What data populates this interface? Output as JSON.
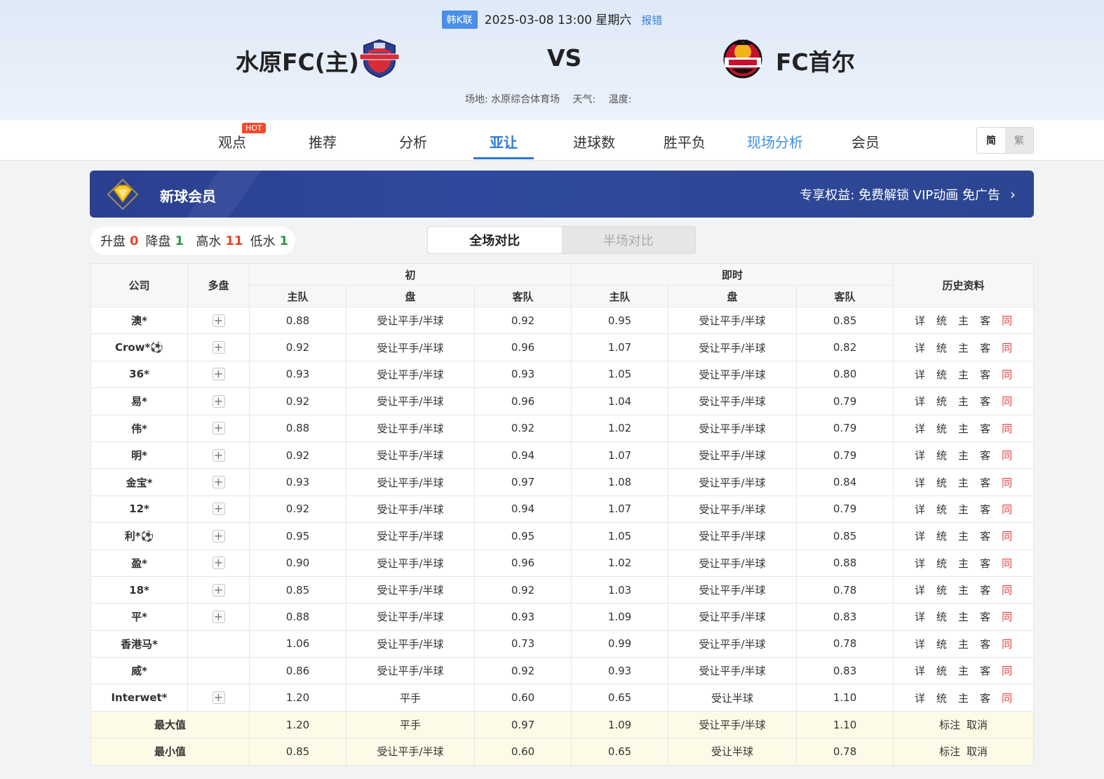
{
  "header": {
    "league": "韩K联",
    "datetime": "2025-03-08 13:00 星期六",
    "report": "报错",
    "home_team": "水原FC(主)",
    "vs": "VS",
    "away_team": "FC首尔",
    "venue": "场地: 水原综合体育场",
    "weather": "天气:",
    "temperature": "温度:"
  },
  "tabs": [
    {
      "label": "观点"
    },
    {
      "label": "推荐"
    },
    {
      "label": "分析"
    },
    {
      "label": "亚让"
    },
    {
      "label": "进球数"
    },
    {
      "label": "胜平负"
    },
    {
      "label": "现场分析"
    },
    {
      "label": "会员"
    }
  ],
  "hot_badge": "HOT",
  "lang": {
    "simplified": "简",
    "traditional": "繁"
  },
  "vip": {
    "title": "新球会员",
    "right": "专享权益: 免费解锁 VIP动画 免广告",
    "chevron": "›"
  },
  "stats": {
    "up_label": "升盘",
    "up_value": "0",
    "down_label": "降盘",
    "down_value": "1",
    "high_label": "高水",
    "high_value": "11",
    "low_label": "低水",
    "low_value": "1"
  },
  "toggle": {
    "full": "全场对比",
    "half": "半场对比"
  },
  "table": {
    "headers": {
      "company": "公司",
      "multi": "多盘",
      "initial": "初",
      "live": "即时",
      "history": "历史资料",
      "home": "主队",
      "line": "盘",
      "away": "客队"
    },
    "history_links": [
      "详",
      "统",
      "主",
      "客",
      "同"
    ],
    "plus": "+",
    "rows": [
      {
        "company": "澳*",
        "plus": true,
        "i_home": "0.88",
        "i_line": "受让平手/半球",
        "i_away": "0.92",
        "l_home": "0.95",
        "l_line": "受让平手/半球",
        "l_away": "0.85"
      },
      {
        "company": "Crow*⚽",
        "plus": true,
        "i_home": "0.92",
        "i_line": "受让平手/半球",
        "i_away": "0.96",
        "l_home": "1.07",
        "l_line": "受让平手/半球",
        "l_away": "0.82"
      },
      {
        "company": "36*",
        "plus": true,
        "i_home": "0.93",
        "i_line": "受让平手/半球",
        "i_away": "0.93",
        "l_home": "1.05",
        "l_line": "受让平手/半球",
        "l_away": "0.80"
      },
      {
        "company": "易*",
        "plus": true,
        "i_home": "0.92",
        "i_line": "受让平手/半球",
        "i_away": "0.96",
        "l_home": "1.04",
        "l_line": "受让平手/半球",
        "l_away": "0.79"
      },
      {
        "company": "伟*",
        "plus": true,
        "i_home": "0.88",
        "i_line": "受让平手/半球",
        "i_away": "0.92",
        "l_home": "1.02",
        "l_line": "受让平手/半球",
        "l_away": "0.79"
      },
      {
        "company": "明*",
        "plus": true,
        "i_home": "0.92",
        "i_line": "受让平手/半球",
        "i_away": "0.94",
        "l_home": "1.07",
        "l_line": "受让平手/半球",
        "l_away": "0.79"
      },
      {
        "company": "金宝*",
        "plus": true,
        "i_home": "0.93",
        "i_line": "受让平手/半球",
        "i_away": "0.97",
        "l_home": "1.08",
        "l_line": "受让平手/半球",
        "l_away": "0.84"
      },
      {
        "company": "12*",
        "plus": true,
        "i_home": "0.92",
        "i_line": "受让平手/半球",
        "i_away": "0.94",
        "l_home": "1.07",
        "l_line": "受让平手/半球",
        "l_away": "0.79"
      },
      {
        "company": "利*⚽",
        "plus": true,
        "i_home": "0.95",
        "i_line": "受让平手/半球",
        "i_away": "0.95",
        "l_home": "1.05",
        "l_line": "受让平手/半球",
        "l_away": "0.85"
      },
      {
        "company": "盈*",
        "plus": true,
        "i_home": "0.90",
        "i_line": "受让平手/半球",
        "i_away": "0.96",
        "l_home": "1.02",
        "l_line": "受让平手/半球",
        "l_away": "0.88"
      },
      {
        "company": "18*",
        "plus": true,
        "i_home": "0.85",
        "i_line": "受让平手/半球",
        "i_away": "0.92",
        "l_home": "1.03",
        "l_line": "受让平手/半球",
        "l_away": "0.78"
      },
      {
        "company": "平*",
        "plus": true,
        "i_home": "0.88",
        "i_line": "受让平手/半球",
        "i_away": "0.93",
        "l_home": "1.09",
        "l_line": "受让平手/半球",
        "l_away": "0.83"
      },
      {
        "company": "香港马*",
        "plus": false,
        "i_home": "1.06",
        "i_line": "受让平手/半球",
        "i_away": "0.73",
        "l_home": "0.99",
        "l_line": "受让平手/半球",
        "l_away": "0.78"
      },
      {
        "company": "威*",
        "plus": false,
        "i_home": "0.86",
        "i_line": "受让平手/半球",
        "i_away": "0.92",
        "l_home": "0.93",
        "l_line": "受让平手/半球",
        "l_away": "0.83"
      },
      {
        "company": "Interwet*",
        "plus": true,
        "i_home": "1.20",
        "i_line": "平手",
        "i_away": "0.60",
        "l_home": "0.65",
        "l_line": "受让半球",
        "l_away": "1.10"
      }
    ],
    "summary": [
      {
        "label": "最大值",
        "i_home": "1.20",
        "i_line": "平手",
        "i_away": "0.97",
        "l_home": "1.09",
        "l_line": "受让平手/半球",
        "l_away": "1.10",
        "mark": "标注",
        "cancel": "取消"
      },
      {
        "label": "最小值",
        "i_home": "0.85",
        "i_line": "受让平手/半球",
        "i_away": "0.60",
        "l_home": "0.65",
        "l_line": "受让半球",
        "l_away": "0.78",
        "mark": "标注",
        "cancel": "取消"
      }
    ]
  }
}
